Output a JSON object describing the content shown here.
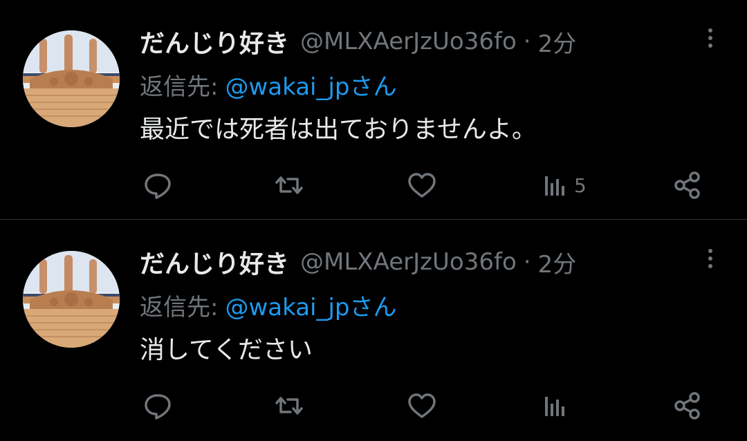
{
  "colors": {
    "background": "#000000",
    "text_primary": "#e7e9ea",
    "text_secondary": "#71767b",
    "link": "#1d9bf0",
    "divider": "#2f3336"
  },
  "tweets": [
    {
      "avatar_icon": "danjiri-avatar",
      "display_name": "だんじり好き",
      "handle": "@MLXAerJzUo36fo",
      "separator": "·",
      "time": "2分",
      "reply_prefix": "返信先:",
      "reply_mention": "@wakai_jpさん",
      "text": "最近では死者は出ておりませんよ。",
      "actions": {
        "reply_icon": "reply-icon",
        "retweet_icon": "retweet-icon",
        "like_icon": "like-icon",
        "views_icon": "views-icon",
        "views_count": "5",
        "share_icon": "share-icon"
      }
    },
    {
      "avatar_icon": "danjiri-avatar",
      "display_name": "だんじり好き",
      "handle": "@MLXAerJzUo36fo",
      "separator": "·",
      "time": "2分",
      "reply_prefix": "返信先:",
      "reply_mention": "@wakai_jpさん",
      "text": "消してください",
      "actions": {
        "reply_icon": "reply-icon",
        "retweet_icon": "retweet-icon",
        "like_icon": "like-icon",
        "views_icon": "views-icon",
        "views_count": "",
        "share_icon": "share-icon"
      }
    }
  ]
}
